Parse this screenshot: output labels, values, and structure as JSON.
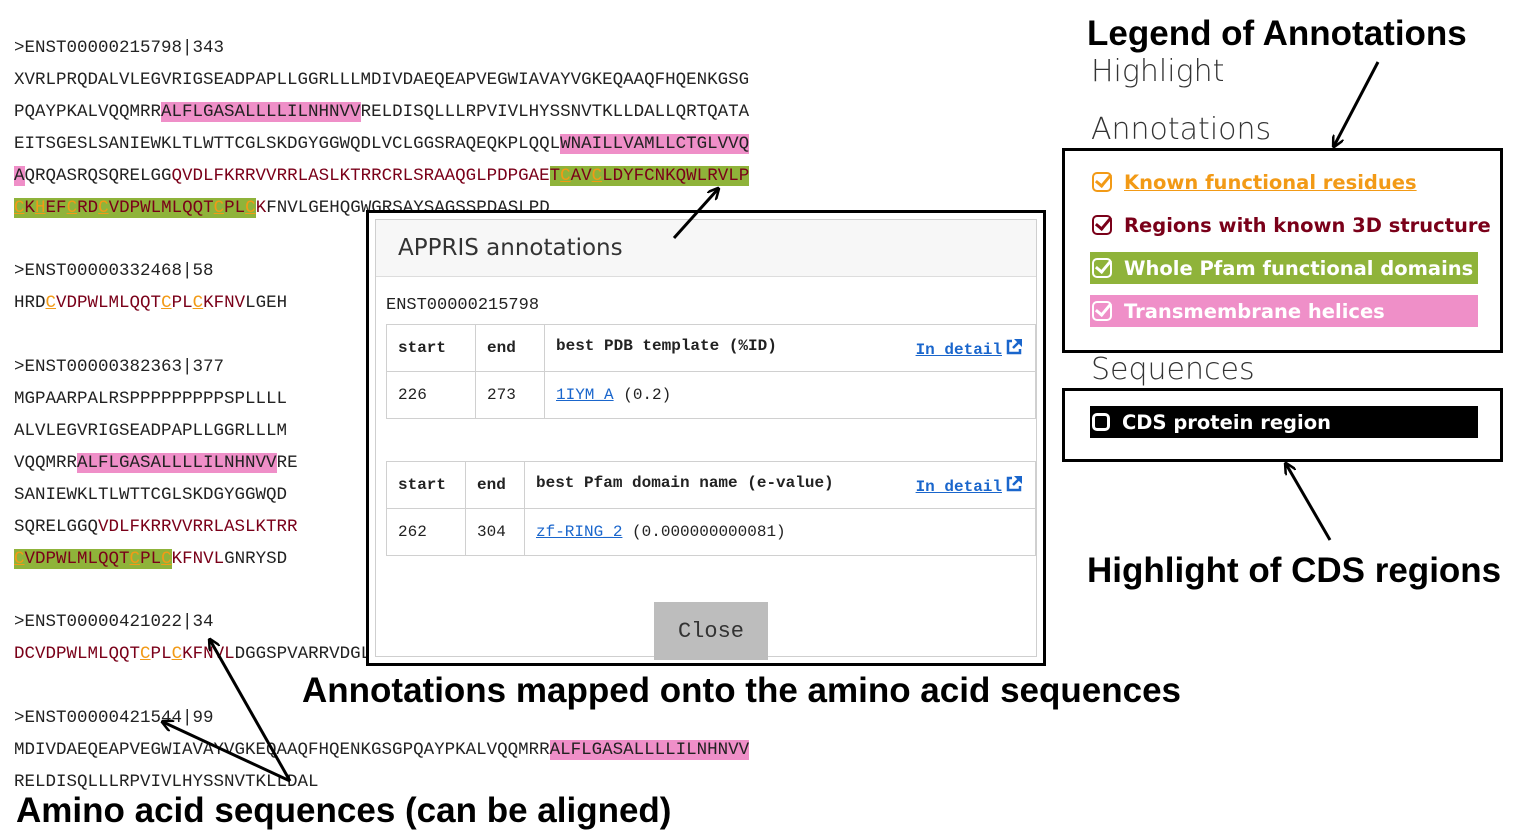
{
  "sequences": [
    {
      "header": ">ENST00000215798|343",
      "lines": [
        [
          {
            "t": "XVRLPRQDALVLEGVRIGSEADPAPLLGGRLLLMDIVDAEQEAPVEGWIAVAYVGKEQAAQFHQENKGSG",
            "c": "n"
          }
        ],
        [
          {
            "t": "PQAYPKALVQQMRR",
            "c": "n"
          },
          {
            "t": "ALFLGASALLLLILNHNVV",
            "c": "tm"
          },
          {
            "t": "RELDISQLLLRPVIVLHYSSNVTKLLDALLQRTQATA",
            "c": "n"
          }
        ],
        [
          {
            "t": "EITSGESLSANIEWKLTLWTTCGLSKDGYGGWQDLVCLGGSRAQEQKPLQQL",
            "c": "n"
          },
          {
            "t": "WNAILLVAMLLCTGLVVQ",
            "c": "tm"
          }
        ],
        [
          {
            "t": "A",
            "c": "tm"
          },
          {
            "t": "QRQASRQSQRELGG",
            "c": "n"
          },
          {
            "t": "QVDLFKRRVVRRLASLKTRRCRLSRAAQGLPDPGAE",
            "c": "s3d"
          },
          {
            "t": "T",
            "c": "pfam s3d"
          },
          {
            "t": "C",
            "c": "pfam fr"
          },
          {
            "t": "AV",
            "c": "pfam s3d"
          },
          {
            "t": "C",
            "c": "pfam fr"
          },
          {
            "t": "LDYFCNKQWLRVLP",
            "c": "pfam s3d"
          }
        ],
        [
          {
            "t": "C",
            "c": "pfam fr"
          },
          {
            "t": "K",
            "c": "pfam s3d"
          },
          {
            "t": "H",
            "c": "pfam fr"
          },
          {
            "t": "EF",
            "c": "pfam s3d"
          },
          {
            "t": "C",
            "c": "pfam fr"
          },
          {
            "t": "RD",
            "c": "pfam s3d"
          },
          {
            "t": "C",
            "c": "pfam fr"
          },
          {
            "t": "VDPWLMLQQT",
            "c": "pfam s3d"
          },
          {
            "t": "C",
            "c": "pfam fr"
          },
          {
            "t": "PL",
            "c": "pfam s3d"
          },
          {
            "t": "C",
            "c": "pfam fr"
          },
          {
            "t": "K",
            "c": "s3d"
          },
          {
            "t": "FNVLGEHQGWGRSAYSAGSSPDASLPD",
            "c": "n"
          }
        ]
      ]
    },
    {
      "header": ">ENST00000332468|58",
      "lines": [
        [
          {
            "t": "HRD",
            "c": "n"
          },
          {
            "t": "C",
            "c": "fr"
          },
          {
            "t": "VDPWLMLQQT",
            "c": "s3d"
          },
          {
            "t": "C",
            "c": "fr"
          },
          {
            "t": "PL",
            "c": "s3d"
          },
          {
            "t": "C",
            "c": "fr"
          },
          {
            "t": "KFNV",
            "c": "s3d"
          },
          {
            "t": "LGEH",
            "c": "n"
          }
        ]
      ]
    },
    {
      "header": ">ENST00000382363|377",
      "lines": [
        [
          {
            "t": "MGPAARPALRSPPPPPPPPPSPLLLL",
            "c": "n"
          }
        ],
        [
          {
            "t": "ALVLEGVRIGSEADPAPLLGGRLLLM",
            "c": "n"
          }
        ],
        [
          {
            "t": "VQQMRR",
            "c": "n"
          },
          {
            "t": "ALFLGASALLLLILNHNVV",
            "c": "tm"
          },
          {
            "t": "RE",
            "c": "n"
          }
        ],
        [
          {
            "t": "SANIEWKLTLWTTCGLSKDGYGGWQD",
            "c": "n"
          }
        ],
        [
          {
            "t": "SQRELGGQ",
            "c": "n"
          },
          {
            "t": "VDLFKRRVVRRLASLKTRR",
            "c": "s3d"
          }
        ],
        [
          {
            "t": "C",
            "c": "pfam fr"
          },
          {
            "t": "VDPWLMLQQT",
            "c": "pfam s3d"
          },
          {
            "t": "C",
            "c": "pfam fr"
          },
          {
            "t": "PL",
            "c": "pfam s3d"
          },
          {
            "t": "C",
            "c": "pfam fr"
          },
          {
            "t": "KFNVL",
            "c": "s3d"
          },
          {
            "t": "GNRYSD",
            "c": "n"
          }
        ]
      ]
    },
    {
      "header": ">ENST00000421022|34",
      "lines": [
        [
          {
            "t": "DCVDPWLMLQQT",
            "c": "s3d"
          },
          {
            "t": "C",
            "c": "fr"
          },
          {
            "t": "P",
            "c": "s3d"
          },
          {
            "t": "L",
            "c": "s3d"
          },
          {
            "t": "C",
            "c": "fr"
          },
          {
            "t": "KFNVL",
            "c": "s3d"
          },
          {
            "t": "DGGSPVARRVDGL",
            "c": "n"
          }
        ]
      ]
    },
    {
      "header": ">ENST00000421544|99",
      "lines": [
        [
          {
            "t": "MDIVDAEQEAPVEGWIAVAYVGKEQAAQFHQENKGSGPQAYPKALVQQMRR",
            "c": "n"
          },
          {
            "t": "ALFLGASALLLLILNHNVV",
            "c": "tm"
          }
        ],
        [
          {
            "t": "RELDISQLLLRPVIVLHYSSNVTKLLDAL",
            "c": "n"
          }
        ]
      ]
    }
  ],
  "modal": {
    "title": "APPRIS annotations",
    "transcript_id": "ENST00000215798",
    "table1": {
      "headers": [
        "start",
        "end",
        "best PDB template (%ID)"
      ],
      "detail_label": "In detail",
      "row": {
        "start": "226",
        "end": "273",
        "link": "1IYM_A",
        "extra": "(0.2)"
      }
    },
    "table2": {
      "headers": [
        "start",
        "end",
        "best Pfam domain name (e-value)"
      ],
      "detail_label": "In detail",
      "row": {
        "start": "262",
        "end": "304",
        "link": "zf-RING_2",
        "extra": "(0.000000000081)"
      }
    },
    "close_label": "Close"
  },
  "legend": {
    "title": "Legend of Annotations",
    "highlight_label": "Highlight",
    "annotations_label": "Annotations",
    "items": [
      {
        "label": "Known functional residues",
        "color": "#f29a16"
      },
      {
        "label": "Regions with known 3D structure",
        "color": "#7a0019"
      },
      {
        "label": "Whole Pfam functional domains",
        "color": "#8fb33a"
      },
      {
        "label": "Transmembrane helices",
        "color": "#ef8fc8"
      }
    ],
    "sequences_label": "Sequences",
    "cds_label": "CDS protein region"
  },
  "callouts": {
    "cds": "Highlight of CDS regions",
    "mapped": "Annotations mapped onto the amino acid sequences",
    "aligned": "Amino acid sequences (can be aligned)"
  },
  "colors": {
    "transmembrane": "#ef8fc8",
    "pfam": "#8fb33a",
    "structure3d": "#7a0019",
    "functional": "#f29a16",
    "cds": "#000000"
  }
}
